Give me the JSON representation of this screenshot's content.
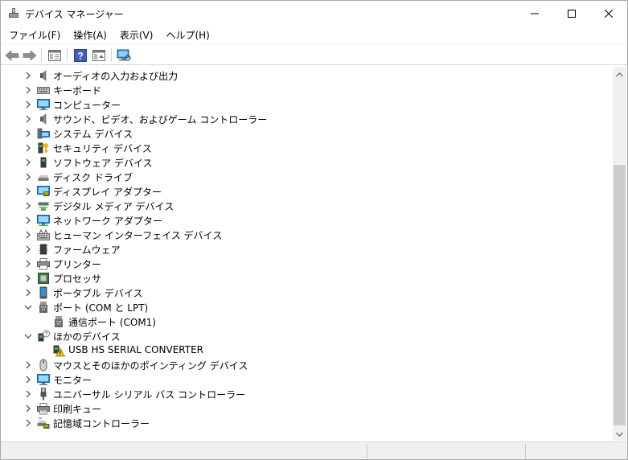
{
  "window": {
    "title": "デバイス マネージャー"
  },
  "menu": [
    {
      "label": "ファイル(F)"
    },
    {
      "label": "操作(A)"
    },
    {
      "label": "表示(V)"
    },
    {
      "label": "ヘルプ(H)"
    }
  ],
  "toolbar": {
    "buttons": [
      "back-icon",
      "forward-icon",
      "properties-icon",
      "help-icon",
      "driver-update-icon",
      "scan-hardware-icon"
    ]
  },
  "tree": {
    "items": [
      {
        "label": "オーディオの入力および出力",
        "icon": "audio-io-icon",
        "expand": "collapsed",
        "level": 0
      },
      {
        "label": "キーボード",
        "icon": "keyboard-icon",
        "expand": "collapsed",
        "level": 0
      },
      {
        "label": "コンピューター",
        "icon": "computer-icon",
        "expand": "collapsed",
        "level": 0
      },
      {
        "label": "サウンド、ビデオ、およびゲーム コントローラー",
        "icon": "speaker-icon",
        "expand": "collapsed",
        "level": 0
      },
      {
        "label": "システム デバイス",
        "icon": "system-device-icon",
        "expand": "collapsed",
        "level": 0
      },
      {
        "label": "セキュリティ デバイス",
        "icon": "security-key-icon",
        "expand": "collapsed",
        "level": 0
      },
      {
        "label": "ソフトウェア デバイス",
        "icon": "software-device-icon",
        "expand": "collapsed",
        "level": 0
      },
      {
        "label": "ディスク ドライブ",
        "icon": "disk-drive-icon",
        "expand": "collapsed",
        "level": 0
      },
      {
        "label": "ディスプレイ アダプター",
        "icon": "display-adapter-icon",
        "expand": "collapsed",
        "level": 0
      },
      {
        "label": "デジタル メディア デバイス",
        "icon": "digital-media-icon",
        "expand": "collapsed",
        "level": 0
      },
      {
        "label": "ネットワーク アダプター",
        "icon": "network-adapter-icon",
        "expand": "collapsed",
        "level": 0
      },
      {
        "label": "ヒューマン インターフェイス デバイス",
        "icon": "hid-icon",
        "expand": "collapsed",
        "level": 0
      },
      {
        "label": "ファームウェア",
        "icon": "firmware-icon",
        "expand": "collapsed",
        "level": 0
      },
      {
        "label": "プリンター",
        "icon": "printer-icon",
        "expand": "collapsed",
        "level": 0
      },
      {
        "label": "プロセッサ",
        "icon": "processor-icon",
        "expand": "collapsed",
        "level": 0
      },
      {
        "label": "ポータブル デバイス",
        "icon": "portable-device-icon",
        "expand": "collapsed",
        "level": 0
      },
      {
        "label": "ポート (COM と LPT)",
        "icon": "port-icon",
        "expand": "expanded",
        "level": 0
      },
      {
        "label": "通信ポート (COM1)",
        "icon": "port-icon",
        "expand": "none",
        "level": 1
      },
      {
        "label": "ほかのデバイス",
        "icon": "unknown-device-icon",
        "expand": "expanded",
        "level": 0
      },
      {
        "label": "USB HS SERIAL CONVERTER",
        "icon": "warning-device-icon",
        "expand": "none",
        "level": 1
      },
      {
        "label": "マウスとそのほかのポインティング デバイス",
        "icon": "mouse-icon",
        "expand": "collapsed",
        "level": 0
      },
      {
        "label": "モニター",
        "icon": "monitor-icon",
        "expand": "collapsed",
        "level": 0
      },
      {
        "label": "ユニバーサル シリアル バス コントローラー",
        "icon": "usb-icon",
        "expand": "collapsed",
        "level": 0
      },
      {
        "label": "印刷キュー",
        "icon": "print-queue-icon",
        "expand": "collapsed",
        "level": 0
      },
      {
        "label": "記憶域コントローラー",
        "icon": "storage-controller-icon",
        "expand": "collapsed",
        "level": 0
      }
    ]
  },
  "colors": {
    "monitor_blue": "#2f8fd8",
    "scroll_thumb": "#cdcdcd",
    "warning_yellow": "#f5c400"
  }
}
